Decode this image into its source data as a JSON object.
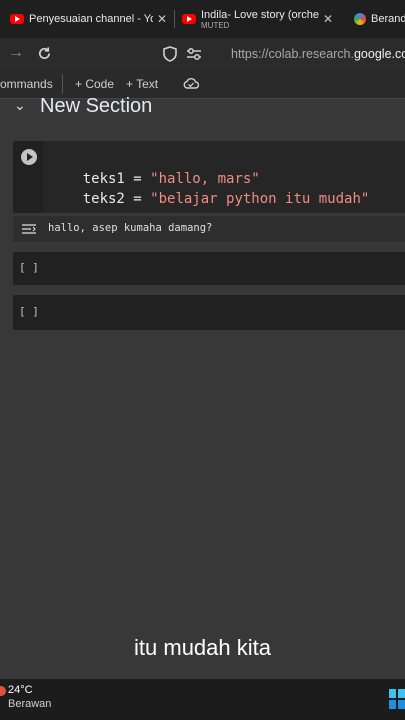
{
  "browser": {
    "tabs": [
      {
        "label": "Penyesuaian channel - YouT",
        "icon": "youtube-icon"
      },
      {
        "label": "Indila- Love story (orchestra",
        "sub": "MUTED",
        "icon": "youtube-icon"
      },
      {
        "label": "Beranda",
        "icon": "gemini-icon"
      }
    ],
    "url_prefix": "https://colab.research.",
    "url_domain": "google.com",
    "url_suffix": "/"
  },
  "colab_toolbar": {
    "commands": "ommands",
    "code": "+ Code",
    "text": "+ Text"
  },
  "section": {
    "title": "New Section"
  },
  "code_cell": {
    "line1_var": "teks1 = ",
    "line1_str": "\"hallo, mars\"",
    "line2_var": "teks2 = ",
    "line2_str": "\"belajar python itu mudah\""
  },
  "output": {
    "text": "hallo, asep kumaha damang?"
  },
  "empty_cells": [
    "[ ]",
    "[ ]"
  ],
  "caption": "itu mudah kita",
  "taskbar": {
    "temperature": "24°C",
    "weather": "Berawan"
  }
}
